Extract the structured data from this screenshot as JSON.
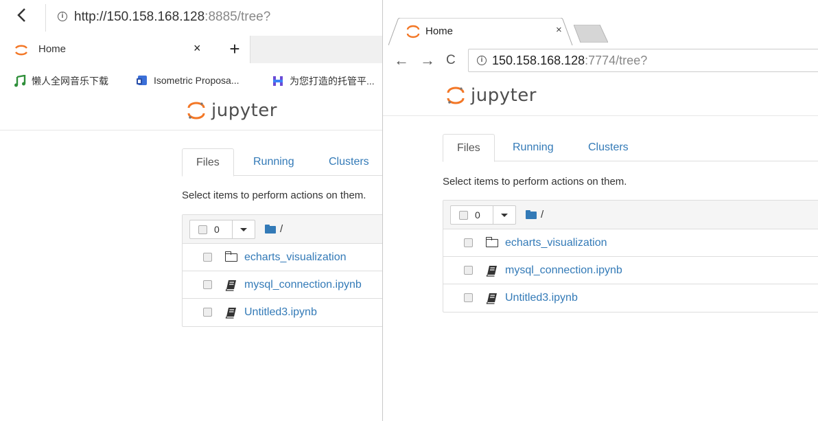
{
  "left_window": {
    "address": {
      "host": "http://150.158.168.128",
      "rest": ":8885/tree?"
    },
    "tab": {
      "title": "Home",
      "close": "×",
      "new_tab": "+"
    },
    "bookmarks": [
      {
        "label": "懒人全网音乐下载",
        "icon": "music-note-icon",
        "color": "#2f8f3a"
      },
      {
        "label": "Isometric Proposa...",
        "icon": "isometric-app-icon",
        "color": "#3a6fd8"
      },
      {
        "label": "为您打造的托管平...",
        "icon": "hosting-h-icon",
        "color": "#6a4bd6"
      }
    ],
    "jupyter": {
      "logo_text": "jupyter"
    },
    "nav_tabs": [
      "Files",
      "Running",
      "Clusters"
    ],
    "hint": "Select items to perform actions on them.",
    "list": {
      "selected_count": "0",
      "breadcrumb": "/",
      "items": [
        {
          "name": "echarts_visualization",
          "type": "folder"
        },
        {
          "name": "mysql_connection.ipynb",
          "type": "notebook"
        },
        {
          "name": "Untitled3.ipynb",
          "type": "notebook"
        }
      ]
    }
  },
  "right_window": {
    "tab": {
      "title": "Home",
      "close": "×"
    },
    "nav": {
      "back": "←",
      "forward": "→",
      "reload": "C"
    },
    "address": {
      "host": "150.158.168.128",
      "rest": ":7774/tree?"
    },
    "jupyter": {
      "logo_text": "jupyter"
    },
    "nav_tabs": [
      "Files",
      "Running",
      "Clusters"
    ],
    "hint": "Select items to perform actions on them.",
    "list": {
      "selected_count": "0",
      "breadcrumb": "/",
      "items": [
        {
          "name": "echarts_visualization",
          "type": "folder"
        },
        {
          "name": "mysql_connection.ipynb",
          "type": "notebook"
        },
        {
          "name": "Untitled3.ipynb",
          "type": "notebook"
        }
      ]
    }
  },
  "colors": {
    "link": "#337ab7",
    "jupyter_orange": "#f37726"
  }
}
